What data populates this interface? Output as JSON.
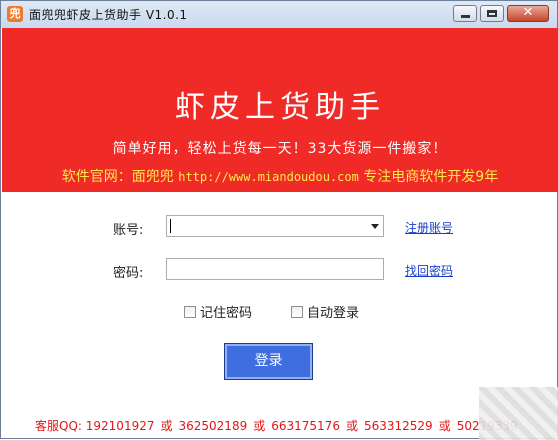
{
  "window": {
    "title": "面兜兜虾皮上货助手 V1.0.1",
    "app_icon_glyph": "兜",
    "close_glyph": "✕"
  },
  "banner": {
    "title": "虾皮上货助手",
    "subtitle": "简单好用，轻松上货每一天！33大货源一件搬家！",
    "site_label": "软件官网：面兜兜",
    "site_url": "http://www.miandoudou.com",
    "site_slogan": "专注电商软件开发9年",
    "bg_color": "#ef2a27",
    "site_color": "#ffe94a"
  },
  "form": {
    "account_label": "账号:",
    "account_value": "",
    "register_link": "注册账号",
    "password_label": "密码:",
    "password_value": "",
    "recover_link": "找回密码",
    "remember_label": "记住密码",
    "remember_checked": false,
    "autologin_label": "自动登录",
    "autologin_checked": false,
    "login_button": "登录"
  },
  "footer": {
    "prefix": "客服QQ:",
    "qq_numbers": [
      "192101927",
      "362502189",
      "663175176",
      "563312529",
      "50219339"
    ],
    "separator": "或"
  },
  "icons": {
    "app": "app-logo-icon",
    "minimize": "minimize-icon",
    "maximize": "maximize-icon",
    "close": "close-icon",
    "dropdown": "chevron-down-icon"
  }
}
